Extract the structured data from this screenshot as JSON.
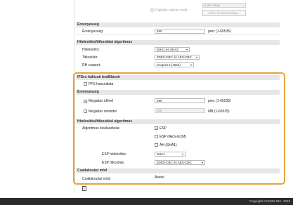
{
  "top": {
    "digital_sig_radio_label": "Digitális aláírás mód",
    "key_name_field": "Kulcs neve",
    "key_name_button": "Kulcs és tanúsítvány..."
  },
  "lifetime1": {
    "title": "Érvényesség",
    "label": "Érvényesség:",
    "value": "480",
    "unit": "perc (1-65535)"
  },
  "auth_enc1": {
    "title": "Hitelesítési/titkosítási algoritmus",
    "auth_label": "Hitelesítés:",
    "auth_value": "SHA1 és SHA2",
    "enc_label": "Titkosítás:",
    "enc_value": "3DES-CBC és AES-CBC",
    "dh_label": "DH csoport:",
    "dh_value": "Csoport 2 (1024)"
  },
  "ipsec": {
    "title": "IPSec hálózati beállítások",
    "pfs_label": "PFS használata",
    "pfs_checked": false
  },
  "lifetime2": {
    "title": "Érvényesség",
    "time_label": "Megadás idővel",
    "time_checked": true,
    "time_value": "480",
    "time_unit": "perc (1-65535)",
    "size_label": "Megadás mérettel",
    "size_checked": false,
    "size_value": "100",
    "size_unit": "MB (1-65535)"
  },
  "auth_enc2": {
    "title": "Hitelesítési/titkosítási algoritmus",
    "algo_label": "Algoritmus kiválasztása:",
    "esp_label": "ESP",
    "esp_checked": true,
    "esp_gcm_label": "ESP (AES-GCM)",
    "esp_gcm_checked": false,
    "ah_label": "AH (SHA1)",
    "ah_checked": false,
    "esp_auth_label": "ESP hitelesítés:",
    "esp_auth_value": "SHA1",
    "esp_enc_label": "ESP titkosítás:",
    "esp_enc_value": "3DES-CBC és AES-CBC"
  },
  "connection": {
    "title": "Csatlakozási mód",
    "label": "Csatlakozási mód:",
    "value": "Átvitel"
  },
  "footer": {
    "copyright": "Copyright CANON INC. 2015"
  },
  "colors": {
    "highlight": "#e8a13a",
    "footer": "#2b2b2b"
  }
}
